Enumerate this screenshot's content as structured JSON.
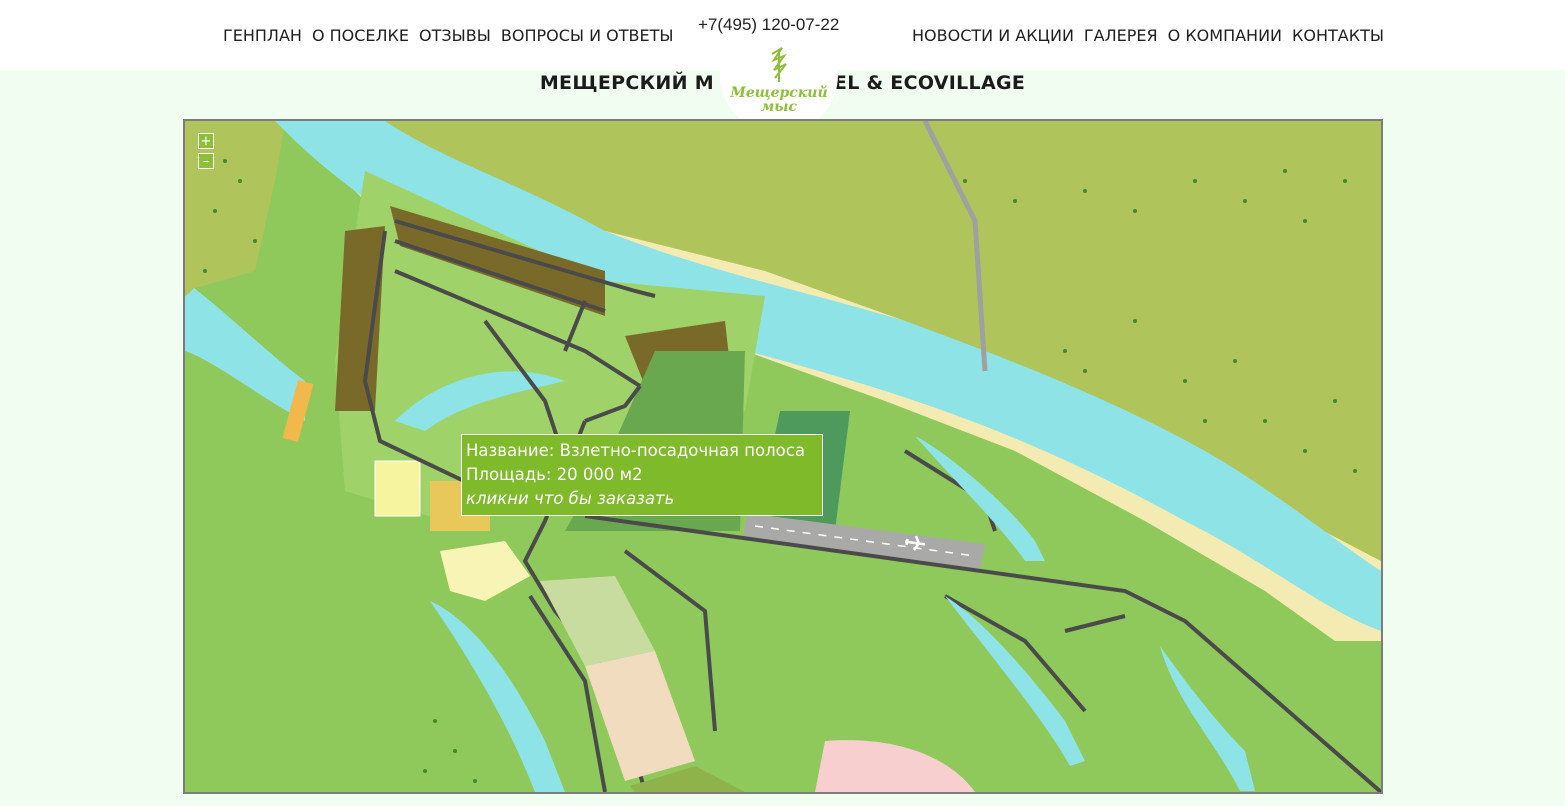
{
  "header": {
    "nav_left": [
      "ГЕНПЛАН",
      "О ПОСЕЛКЕ",
      "ОТЗЫВЫ",
      "ВОПРОСЫ И ОТВЕТЫ"
    ],
    "nav_right": [
      "НОВОСТИ И АКЦИИ",
      "ГАЛЕРЕЯ",
      "О КОМПАНИИ",
      "КОНТАКТЫ"
    ],
    "phone": "+7(495) 120-07-22",
    "title_left": "МЕЩЕРСКИЙ М",
    "title_right": "EL & ECOVILLAGE",
    "logo_line1": "Мещерский",
    "logo_line2": "мыс"
  },
  "map": {
    "zoom_in": "+",
    "zoom_out": "–",
    "tooltip": {
      "name_line": "Название: Взлетно-посадочная полоса",
      "area_line": "Площадь: 20 000 м2",
      "cta": "кликни что бы заказать"
    }
  },
  "colors": {
    "accent": "#7fba2a",
    "river": "#8ee3e6",
    "sand": "#f4ebb3",
    "grass": "#8fc95c",
    "field": "#b0c85a",
    "plots": "#7a6a2a"
  },
  "icons": [
    "airplane-icon",
    "tree-logo-icon"
  ]
}
